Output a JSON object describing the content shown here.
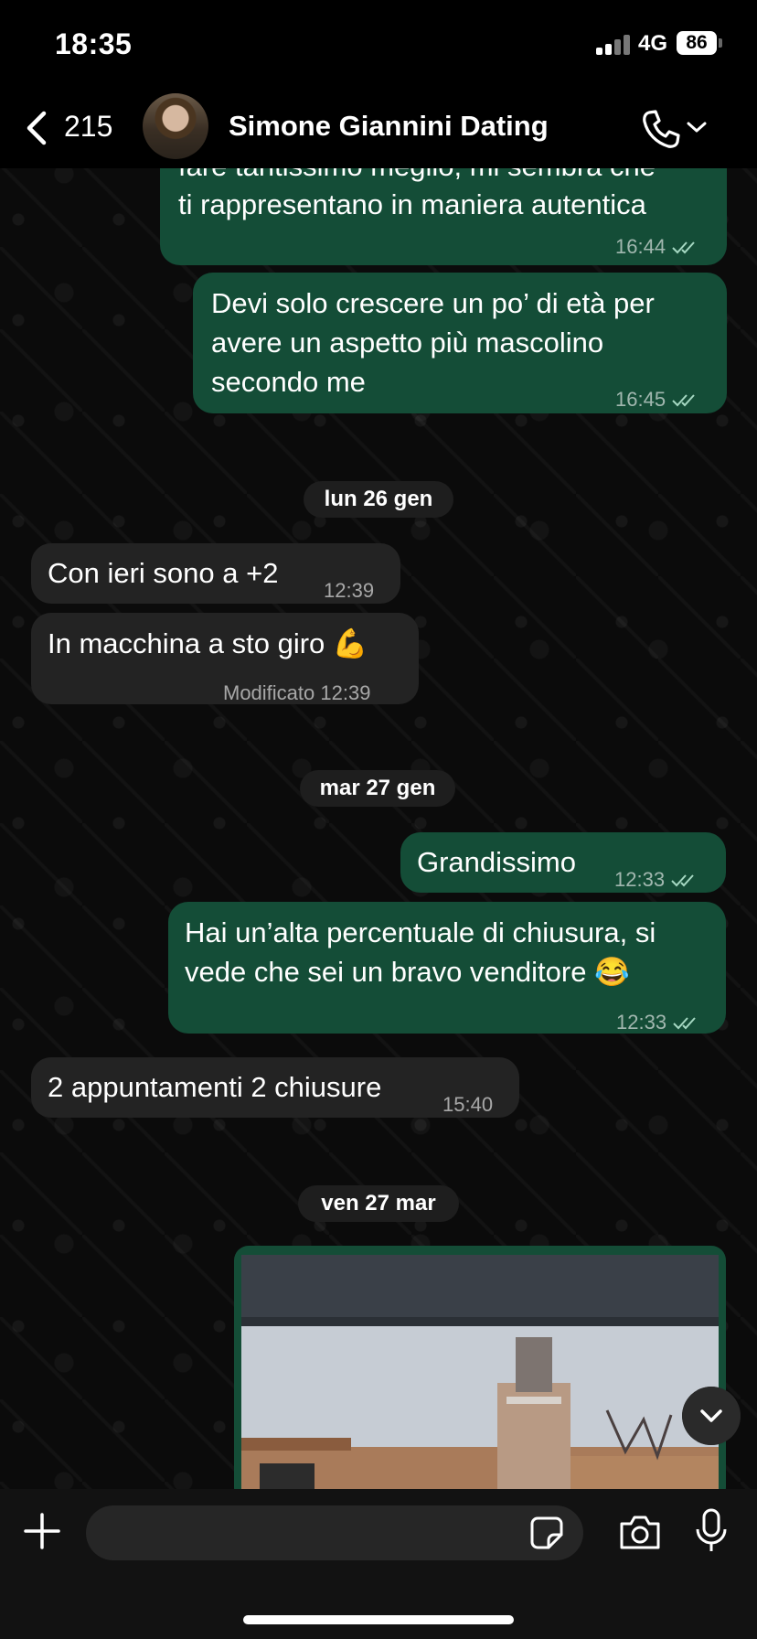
{
  "status_bar": {
    "time": "18:35",
    "network": "4G",
    "battery": "86"
  },
  "header": {
    "back_count": "215",
    "contact_name": "Simone Giannini Dating"
  },
  "messages": [
    {
      "direction": "out",
      "text_partial_top": "fare tantissimo meglio, mi sembra che",
      "text": "ti rappresentano in maniera autentica",
      "time": "16:44",
      "status": "read"
    },
    {
      "direction": "out",
      "text": "Devi solo crescere un po’ di età per avere un aspetto più mascolino secondo me",
      "time": "16:45",
      "status": "read"
    },
    {
      "type": "date",
      "text": "lun 26 gen"
    },
    {
      "direction": "in",
      "text": "Con ieri sono a +2",
      "time": "12:39"
    },
    {
      "direction": "in",
      "text": "In macchina a sto giro 💪",
      "edited_label": "Modificato",
      "time": "12:39"
    },
    {
      "type": "date",
      "text": "mar 27 gen"
    },
    {
      "direction": "out",
      "text": "Grandissimo",
      "time": "12:33",
      "status": "read"
    },
    {
      "direction": "out",
      "text": "Hai un’alta percentuale di chiusura, si vede che sei un bravo venditore 😂",
      "time": "12:33",
      "status": "read"
    },
    {
      "direction": "in",
      "text": "2 appuntamenti 2 chiusure",
      "time": "15:40"
    },
    {
      "type": "date",
      "text": "ven 27 mar"
    },
    {
      "direction": "out",
      "type": "photo"
    }
  ],
  "composer": {
    "placeholder": ""
  },
  "colors": {
    "outgoing": "#144d37",
    "incoming": "#232323",
    "read_ticks": "#a5d8c2",
    "background": "#0b0b0b"
  },
  "icons": [
    "chevron-left-icon",
    "phone-icon",
    "chevron-down-icon",
    "double-check-icon",
    "plus-icon",
    "sticker-icon",
    "camera-icon",
    "microphone-icon",
    "scroll-down-icon"
  ]
}
